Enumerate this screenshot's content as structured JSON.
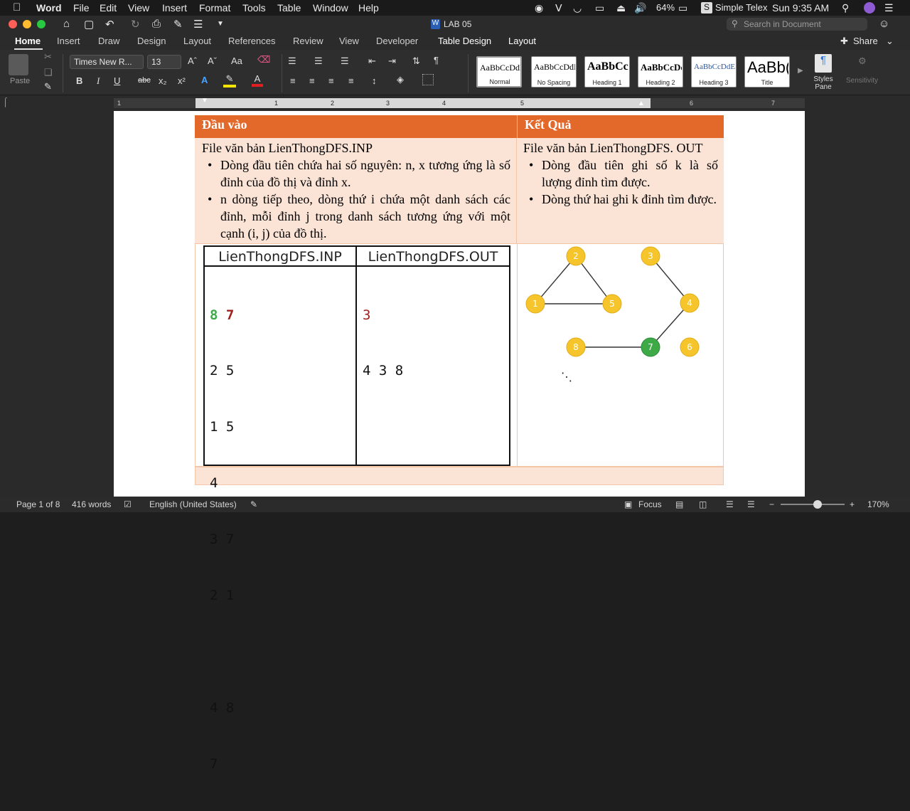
{
  "menubar": {
    "app": "Word",
    "items": [
      "File",
      "Edit",
      "View",
      "Insert",
      "Format",
      "Tools",
      "Table",
      "Window",
      "Help"
    ],
    "battery": "64%",
    "input_method": "Simple Telex",
    "clock": "Sun 9:35 AM"
  },
  "window": {
    "title": "LAB 05",
    "search_placeholder": "Search in Document"
  },
  "ribbon_tabs": {
    "items": [
      "Home",
      "Insert",
      "Draw",
      "Design",
      "Layout",
      "References",
      "Review",
      "View",
      "Developer"
    ],
    "context_items": [
      "Table Design",
      "Layout"
    ],
    "share_label": "Share"
  },
  "ribbon": {
    "paste_label": "Paste",
    "font_name": "Times New R...",
    "font_size": "13",
    "styles": [
      {
        "preview": "AaBbCcDdI",
        "name": "Normal"
      },
      {
        "preview": "AaBbCcDdI",
        "name": "No Spacing"
      },
      {
        "preview": "AaBbCc",
        "name": "Heading 1"
      },
      {
        "preview": "AaBbCcDd",
        "name": "Heading 2"
      },
      {
        "preview": "AaBbCcDdEe",
        "name": "Heading 3"
      },
      {
        "preview": "AaBb(",
        "name": "Title"
      }
    ],
    "styles_pane_label": "Styles Pane",
    "sensitivity_label": "Sensitivity"
  },
  "ruler": {
    "numbers": [
      "1",
      "1",
      "2",
      "3",
      "4",
      "5",
      "6",
      "7"
    ]
  },
  "document": {
    "header_input": "Đầu vào",
    "header_result": "Kết Quả",
    "input_file": "File văn bản LienThongDFS.INP",
    "input_bullets": [
      "Dòng đầu tiên chứa hai số nguyên: n, x tương ứng là số đỉnh của đồ thị và đỉnh x.",
      "n dòng tiếp theo, dòng thứ i chứa một danh sách các đỉnh, mỗi đỉnh j trong danh sách tương ứng với một cạnh (i, j) của đồ thị."
    ],
    "output_file": "File văn bản LienThongDFS. OUT",
    "output_bullets": [
      "Dòng đầu tiên ghi số k là số lượng đỉnh tìm được.",
      "Dòng thứ hai ghi k đỉnh tìm được."
    ],
    "sample": {
      "inp_header": "LienThongDFS.INP",
      "out_header": "LienThongDFS.OUT",
      "inp_first_n": "8",
      "inp_first_x": "7",
      "inp_lines": [
        "2 5",
        "1 5",
        "4",
        "3 7",
        "2 1",
        "",
        "4 8",
        "7"
      ],
      "out_first": "3",
      "out_lines": [
        "4 3 8"
      ]
    },
    "graph": {
      "nodes": [
        "1",
        "2",
        "3",
        "4",
        "5",
        "6",
        "7",
        "8"
      ],
      "edges": [
        [
          "1",
          "2"
        ],
        [
          "1",
          "5"
        ],
        [
          "2",
          "5"
        ],
        [
          "3",
          "4"
        ],
        [
          "4",
          "7"
        ],
        [
          "7",
          "8"
        ]
      ],
      "highlight_node": "7",
      "node_color": "#f5c52b",
      "highlight_color": "#3daa47"
    }
  },
  "statusbar": {
    "page": "Page 1 of 8",
    "words": "416 words",
    "language": "English (United States)",
    "focus": "Focus",
    "zoom": "170%"
  }
}
